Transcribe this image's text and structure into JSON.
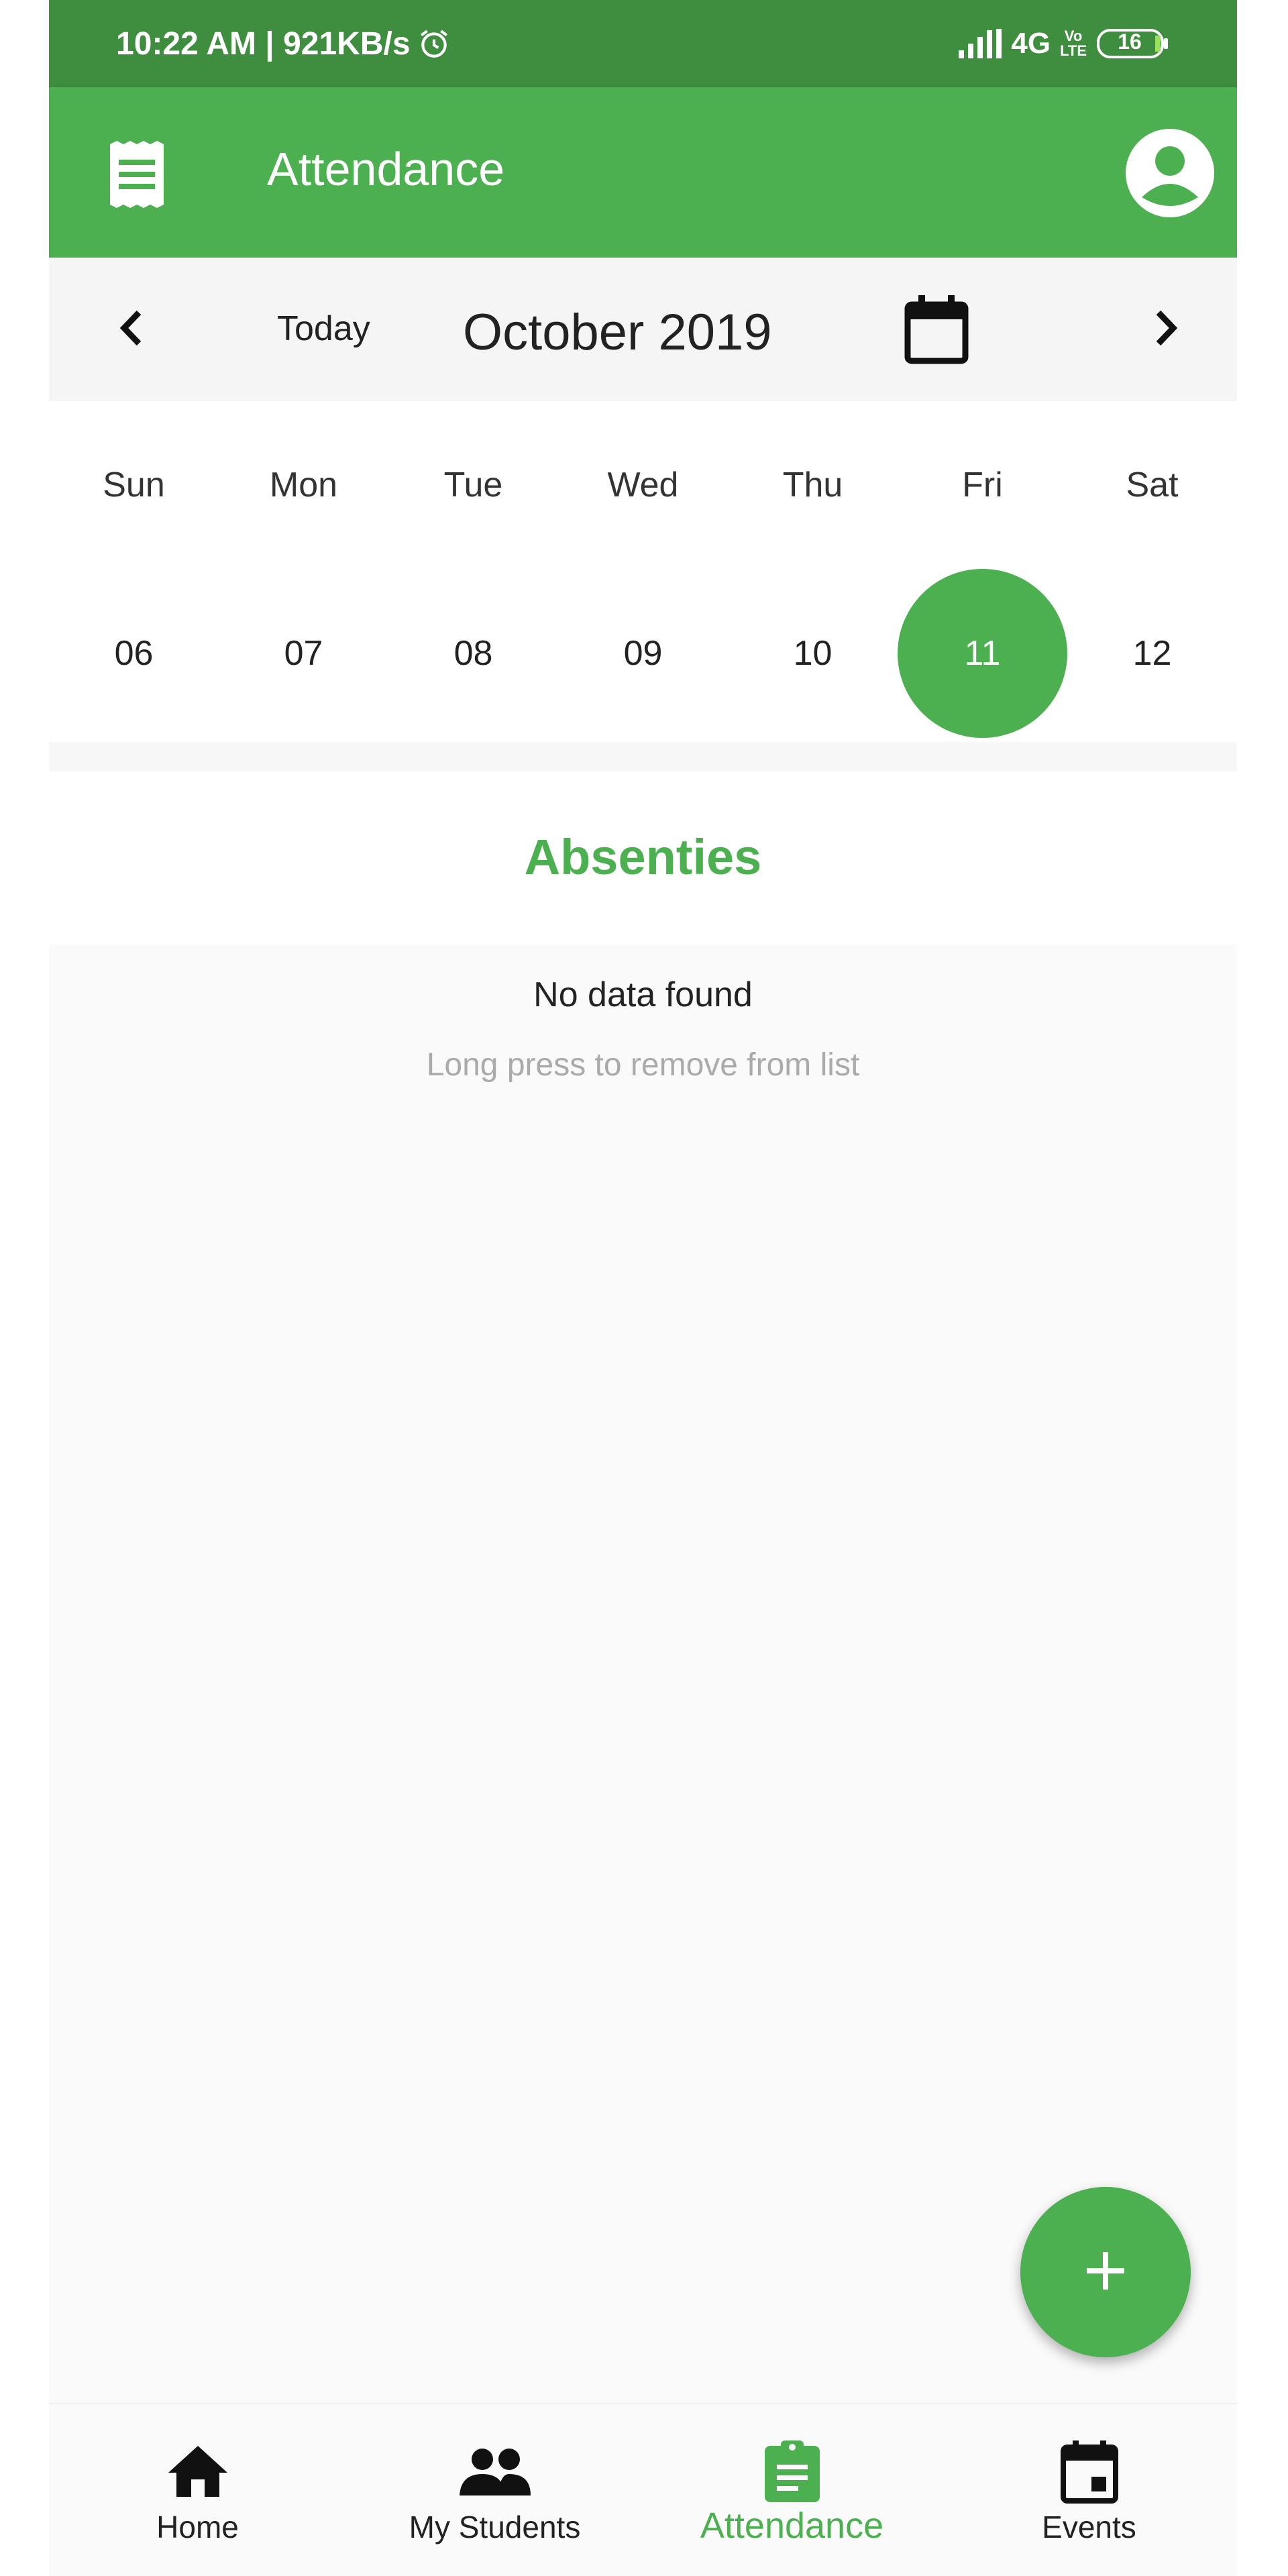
{
  "status_bar": {
    "time_speed": "10:22 AM | 921KB/s",
    "network": "4G",
    "volte_top": "Vo",
    "volte_bottom": "LTE",
    "battery": "16"
  },
  "app_bar": {
    "title": "Attendance",
    "menu_icon": "receipt-icon",
    "profile_icon": "account-circle-icon"
  },
  "month_nav": {
    "today_label": "Today",
    "month_label": "October 2019",
    "prev_icon": "chevron-left-icon",
    "next_icon": "chevron-right-icon",
    "calendar_icon": "calendar-icon"
  },
  "week": {
    "days": [
      {
        "name": "Sun",
        "num": "06"
      },
      {
        "name": "Mon",
        "num": "07"
      },
      {
        "name": "Tue",
        "num": "08"
      },
      {
        "name": "Wed",
        "num": "09"
      },
      {
        "name": "Thu",
        "num": "10"
      },
      {
        "name": "Fri",
        "num": "11"
      },
      {
        "name": "Sat",
        "num": "12"
      }
    ],
    "selected_index": 5
  },
  "section": {
    "title": "Absenties"
  },
  "list": {
    "empty_text": "No data found",
    "hint_text": "Long press to remove from list"
  },
  "fab": {
    "icon": "add-icon"
  },
  "bottom_nav": {
    "items": [
      {
        "label": "Home",
        "icon": "home-icon"
      },
      {
        "label": "My Students",
        "icon": "people-icon"
      },
      {
        "label": "Attendance",
        "icon": "clipboard-icon"
      },
      {
        "label": "Events",
        "icon": "event-icon"
      }
    ],
    "active_index": 2
  },
  "colors": {
    "primary": "#4caf50",
    "status_bar": "#3f8d3e",
    "hint": "#aaaaaa"
  }
}
